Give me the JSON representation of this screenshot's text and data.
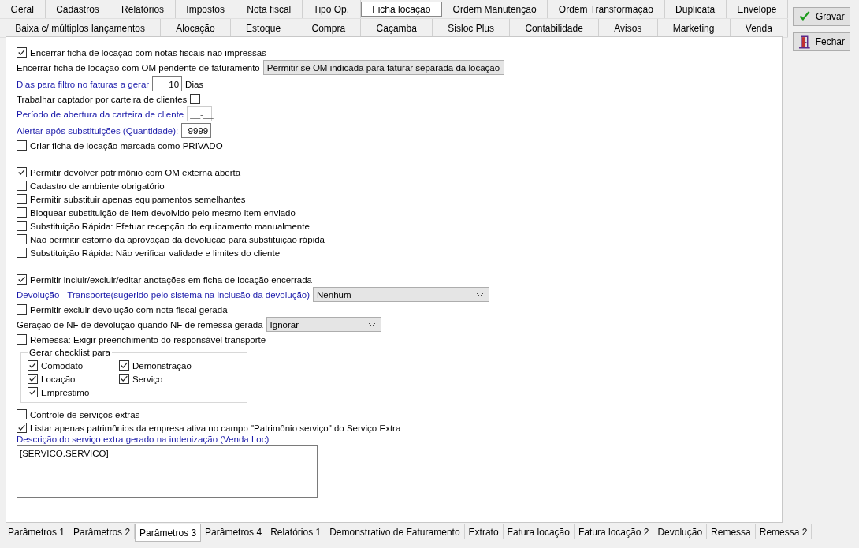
{
  "top_tabs": [
    [
      {
        "label": "Geral",
        "selected": false
      },
      {
        "label": "Cadastros",
        "selected": false
      },
      {
        "label": "Relatórios",
        "selected": false
      },
      {
        "label": "Impostos",
        "selected": false
      },
      {
        "label": "Nota fiscal",
        "selected": false
      },
      {
        "label": "Tipo Op.",
        "selected": false
      },
      {
        "label": "Ficha locação",
        "selected": true
      },
      {
        "label": "Ordem Manutenção",
        "selected": false
      },
      {
        "label": "Ordem Transformação",
        "selected": false
      },
      {
        "label": "Duplicata",
        "selected": false
      },
      {
        "label": "Envelope",
        "selected": false
      }
    ],
    [
      {
        "label": "Baixa c/ múltiplos lançamentos",
        "selected": false
      },
      {
        "label": "Alocação",
        "selected": false
      },
      {
        "label": "Estoque",
        "selected": false
      },
      {
        "label": "Compra",
        "selected": false
      },
      {
        "label": "Caçamba",
        "selected": false
      },
      {
        "label": "Sisloc Plus",
        "selected": false
      },
      {
        "label": "Contabilidade",
        "selected": false
      },
      {
        "label": "Avisos",
        "selected": false
      },
      {
        "label": "Marketing",
        "selected": false
      },
      {
        "label": "Venda",
        "selected": false
      }
    ]
  ],
  "sections": [
    [
      {
        "kind": "checkbox",
        "label": "Encerrar ficha de locação com notas fiscais não impressas",
        "checked": true
      },
      {
        "kind": "select",
        "label": "Encerrar ficha de locação com OM pendente de faturamento",
        "highlighted": false,
        "value": "Permitir se OM indicada para faturar separada da locação"
      },
      {
        "kind": "number",
        "label": "Dias para filtro no faturas a gerar",
        "highlighted": true,
        "value": "10",
        "unit": "Dias"
      },
      {
        "kind": "checkbox-after",
        "label": "Trabalhar captador por carteira de clientes",
        "checked": false
      },
      {
        "kind": "mask",
        "label": "Período de abertura da carteira de cliente",
        "highlighted": true,
        "value": "__-__"
      },
      {
        "kind": "number",
        "label": "Alertar após substituições (Quantidade):",
        "highlighted": true,
        "value": "9999"
      },
      {
        "kind": "checkbox",
        "label": "Criar ficha de locação marcada como PRIVADO",
        "checked": false
      }
    ],
    [
      {
        "kind": "checkbox",
        "label": "Permitir devolver patrimônio com OM externa aberta",
        "checked": true
      },
      {
        "kind": "checkbox",
        "label": "Cadastro de ambiente obrigatório",
        "checked": false
      },
      {
        "kind": "checkbox",
        "label": "Permitir substituir apenas equipamentos semelhantes",
        "checked": false
      },
      {
        "kind": "checkbox",
        "label": "Bloquear substituição de item devolvido pelo mesmo item enviado",
        "checked": false
      },
      {
        "kind": "checkbox",
        "label": "Substituição Rápida: Efetuar recepção do equipamento manualmente",
        "checked": false
      },
      {
        "kind": "checkbox",
        "label": "Não permitir estorno da aprovação da devolução para substituição rápida",
        "checked": false
      },
      {
        "kind": "checkbox",
        "label": "Substituição Rápida: Não verificar validade e limites do cliente",
        "checked": false
      }
    ],
    [
      {
        "kind": "checkbox",
        "label": "Permitir incluir/excluir/editar anotações em ficha de locação encerrada",
        "checked": true
      },
      {
        "kind": "select",
        "label": "Devolução - Transporte(sugerido pelo sistema na inclusão da devolução)",
        "highlighted": true,
        "value": "Nenhum"
      },
      {
        "kind": "checkbox",
        "label": "Permitir excluir devolução com nota fiscal gerada",
        "checked": false
      },
      {
        "kind": "select",
        "label": "Geração de NF de devolução quando NF de remessa gerada",
        "highlighted": false,
        "value": "Ignorar"
      },
      {
        "kind": "checkbox",
        "label": "Remessa: Exigir preenchimento do responsável transporte",
        "checked": false
      },
      {
        "kind": "group",
        "label": "Gerar checklist para",
        "items": [
          {
            "label": "Comodato",
            "checked": true
          },
          {
            "label": "Demonstração",
            "checked": true
          },
          {
            "label": "Locação",
            "checked": true
          },
          {
            "label": "Serviço",
            "checked": true
          },
          {
            "label": "Empréstimo",
            "checked": true
          }
        ]
      },
      {
        "kind": "checkbox",
        "label": "Controle de serviços extras",
        "checked": false
      },
      {
        "kind": "checkbox",
        "label": "Listar apenas patrimônios da empresa ativa no campo \"Patrimônio serviço\" do Serviço Extra",
        "checked": true
      },
      {
        "kind": "memo",
        "label": "Descrição do serviço extra gerado na indenização (Venda Loc)",
        "highlighted": true,
        "value": "[SERVICO.SERVICO]"
      }
    ]
  ],
  "bottom_tabs": [
    {
      "label": "Parâmetros 1",
      "selected": false
    },
    {
      "label": "Parâmetros 2",
      "selected": false
    },
    {
      "label": "Parâmetros 3",
      "selected": true
    },
    {
      "label": "Parâmetros 4",
      "selected": false
    },
    {
      "label": "Relatórios 1",
      "selected": false
    },
    {
      "label": "Demonstrativo de Faturamento",
      "selected": false
    },
    {
      "label": "Extrato",
      "selected": false
    },
    {
      "label": "Fatura locação",
      "selected": false
    },
    {
      "label": "Fatura locação 2",
      "selected": false
    },
    {
      "label": "Devolução",
      "selected": false
    },
    {
      "label": "Remessa",
      "selected": false
    },
    {
      "label": "Remessa 2",
      "selected": false
    }
  ],
  "buttons": [
    {
      "kind": "save",
      "label": "Gravar"
    },
    {
      "kind": "close",
      "label": "Fechar"
    }
  ]
}
